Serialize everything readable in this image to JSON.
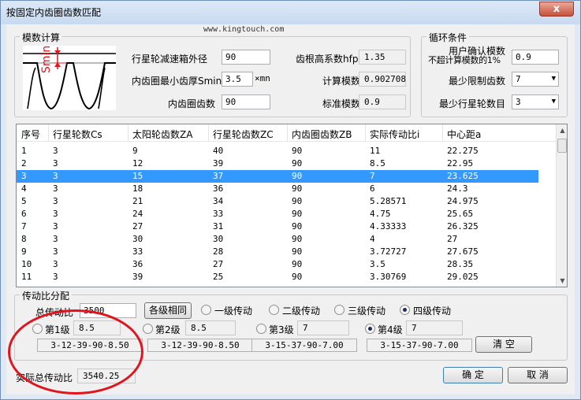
{
  "window": {
    "title": "按固定内齿圈齿数匹配",
    "close": "x"
  },
  "watermark": "www.kingtouch.com",
  "modulus": {
    "group_title": "模数计算",
    "diagram_label": "Smin",
    "planet_gearbox_od_label": "行星轮减速箱外径",
    "planet_gearbox_od_value": "90",
    "ring_min_thickness_label": "内齿圈最小齿厚Smin",
    "ring_min_thickness_value": "3.5",
    "ring_min_thickness_unit": "×mn",
    "ring_teeth_label": "内齿圈齿数",
    "ring_teeth_value": "90",
    "root_height_label": "齿根高系数hfp*",
    "root_height_value": "1.35",
    "calc_modulus_label": "计算模数",
    "calc_modulus_value": "0.902708",
    "std_modulus_label": "标准模数",
    "std_modulus_value": "0.9"
  },
  "loop": {
    "group_title": "循环条件",
    "user_confirm_label_1": "用户确认模数",
    "user_confirm_label_2": "不超计算模数的1%",
    "user_confirm_value": "0.9",
    "min_teeth_label": "最少限制齿数",
    "min_teeth_value": "7",
    "min_planets_label": "最少行星轮数目",
    "min_planets_value": "3"
  },
  "table": {
    "columns": [
      "序号",
      "行星轮数Cs",
      "太阳轮齿数ZA",
      "行星轮齿数ZC",
      "内齿圈齿数ZB",
      "实际传动比i",
      "中心距a"
    ],
    "rows": [
      [
        "1",
        "3",
        "9",
        "40",
        "90",
        "11",
        "22.275"
      ],
      [
        "2",
        "3",
        "12",
        "39",
        "90",
        "8.5",
        "22.95"
      ],
      [
        "3",
        "3",
        "15",
        "37",
        "90",
        "7",
        "23.625"
      ],
      [
        "4",
        "3",
        "18",
        "36",
        "90",
        "6",
        "24.3"
      ],
      [
        "5",
        "3",
        "21",
        "34",
        "90",
        "5.28571",
        "24.975"
      ],
      [
        "6",
        "3",
        "24",
        "33",
        "90",
        "4.75",
        "25.65"
      ],
      [
        "7",
        "3",
        "27",
        "31",
        "90",
        "4.33333",
        "26.325"
      ],
      [
        "8",
        "3",
        "30",
        "30",
        "90",
        "4",
        "27"
      ],
      [
        "9",
        "3",
        "33",
        "28",
        "90",
        "3.72727",
        "27.675"
      ],
      [
        "10",
        "3",
        "36",
        "27",
        "90",
        "3.5",
        "28.35"
      ],
      [
        "11",
        "3",
        "39",
        "25",
        "90",
        "3.30769",
        "29.025"
      ]
    ],
    "selected_row": 2
  },
  "ratio": {
    "group_title": "传动比分配",
    "total_label": "总传动比",
    "total_value": "3500",
    "same_button": "各级相同",
    "stage_options": [
      "一级传动",
      "二级传动",
      "三级传动",
      "四级传动"
    ],
    "stage_selected": 3,
    "stages": [
      {
        "label": "第1级",
        "value": "8.5",
        "code": "3-12-39-90-8.50",
        "checked": false
      },
      {
        "label": "第2级",
        "value": "8.5",
        "code": "3-12-39-90-8.50",
        "checked": false
      },
      {
        "label": "第3级",
        "value": "7",
        "code": "3-15-37-90-7.00",
        "checked": false
      },
      {
        "label": "第4级",
        "value": "7",
        "code": "3-15-37-90-7.00",
        "checked": true
      }
    ],
    "clear_button": "清 空"
  },
  "footer": {
    "actual_total_label": "实际总传动比",
    "actual_total_value": "3540.25",
    "ok_button": "确 定",
    "cancel_button": "取 消"
  },
  "colors": {
    "selection": "#3399ff",
    "annotation": "#e0141e"
  }
}
